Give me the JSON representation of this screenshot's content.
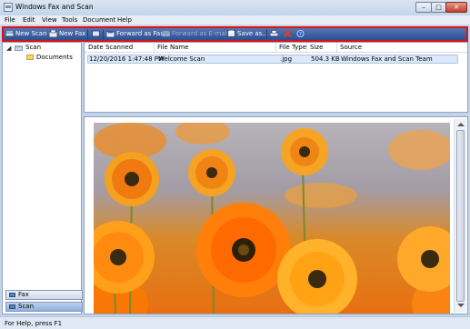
{
  "window": {
    "title": "Windows Fax and Scan"
  },
  "menu": [
    "File",
    "Edit",
    "View",
    "Tools",
    "Document",
    "Help"
  ],
  "toolbar": {
    "new_scan": "New Scan",
    "new_fax": "New Fax",
    "forward_fax": "Forward as Fax",
    "forward_email": "Forward as E-mail",
    "save_as": "Save as...",
    "print_icon": "printer-icon",
    "delete_icon": "delete-icon",
    "help_icon": "help-icon"
  },
  "nav": {
    "root": "Scan",
    "child": "Documents",
    "fax_button": "Fax",
    "scan_button": "Scan"
  },
  "list": {
    "columns": [
      "Date Scanned",
      "File Name",
      "File Type",
      "Size",
      "Source"
    ],
    "rows": [
      {
        "date": "12/20/2016 1:47:48 PM",
        "name": "Welcome Scan",
        "type": ".jpg",
        "size": "504.3 KB",
        "source": "Windows Fax and Scan Team"
      }
    ]
  },
  "status": {
    "text": "For Help, press F1"
  },
  "colors": {
    "toolbar": "#2c4f91",
    "highlight": "#e01010",
    "selection": "#dce9f9"
  }
}
